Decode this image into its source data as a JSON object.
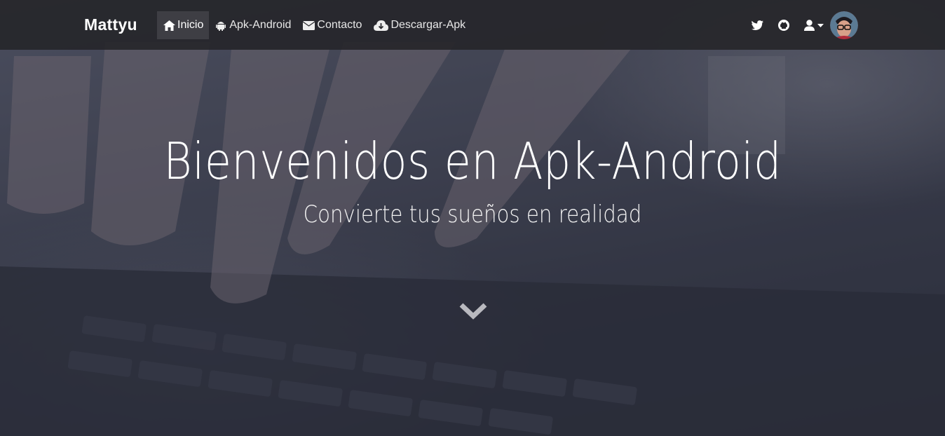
{
  "navbar": {
    "brand": "Mattyu",
    "links": [
      {
        "label": "Inicio",
        "icon": "home-icon",
        "active": true
      },
      {
        "label": "Apk-Android",
        "icon": "android-icon",
        "active": false
      },
      {
        "label": "Contacto",
        "icon": "envelope-icon",
        "active": false
      },
      {
        "label": "Descargar-Apk",
        "icon": "cloud-download-icon",
        "active": false
      }
    ],
    "right_icons": [
      "twitter-icon",
      "github-icon",
      "user-icon",
      "caret-down-icon"
    ],
    "avatar": "avatar"
  },
  "hero": {
    "title": "Bienvenidos en Apk-Android",
    "subtitle": "Convierte tus sueños en realidad",
    "scroll_icon": "chevron-down-icon"
  },
  "colors": {
    "navbar_bg": "#26262a",
    "active_link_bg": "#3e3e44",
    "text": "#ffffff",
    "chevron": "#b9b9bf"
  }
}
